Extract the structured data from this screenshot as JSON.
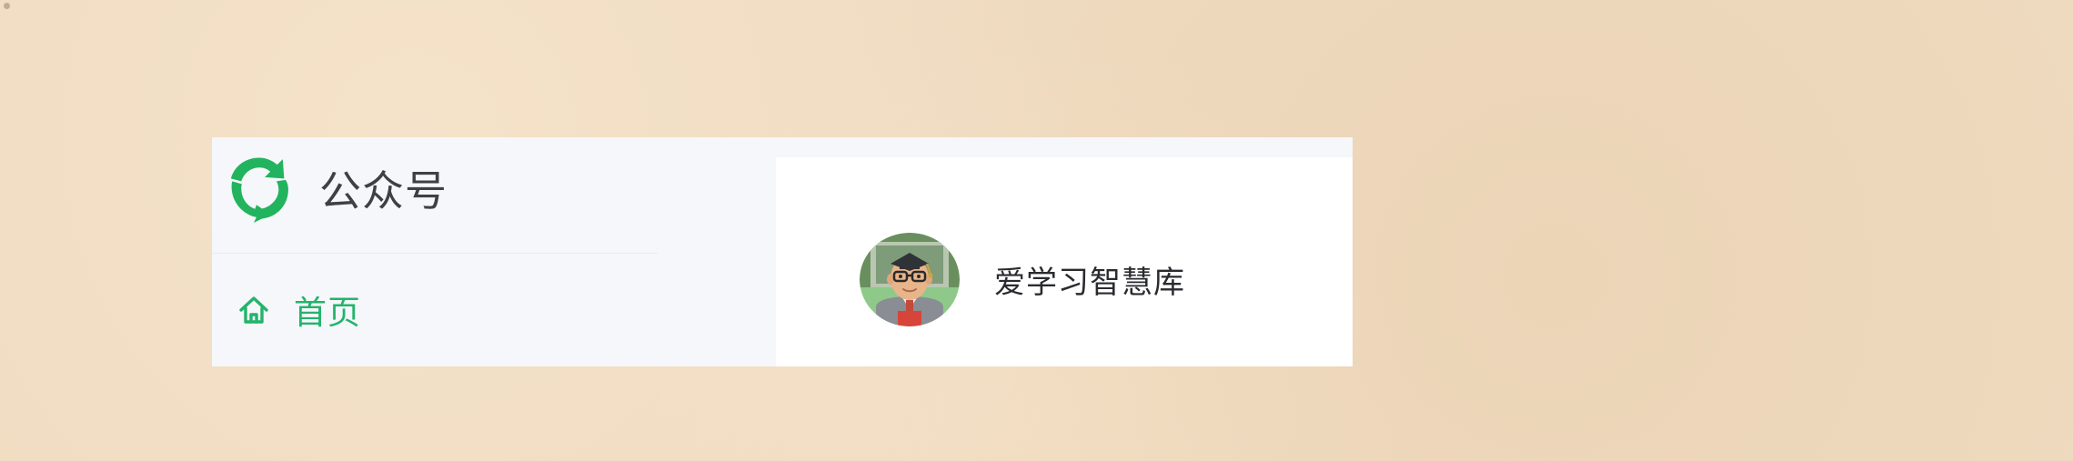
{
  "brand": {
    "title": "公众号",
    "logo_icon": "green-recycle-arrows-icon",
    "logo_color": "#22b35e"
  },
  "nav": {
    "home": {
      "label": "首页",
      "icon": "home-icon",
      "color": "#23b46b"
    }
  },
  "account": {
    "name": "爱学习智慧库",
    "avatar_icon": "graduate-avatar-icon"
  },
  "colors": {
    "page_background": "#efdbc0",
    "sidebar_background": "#f5f7fa",
    "card_background": "#ffffff",
    "accent_green": "#23b46b"
  }
}
